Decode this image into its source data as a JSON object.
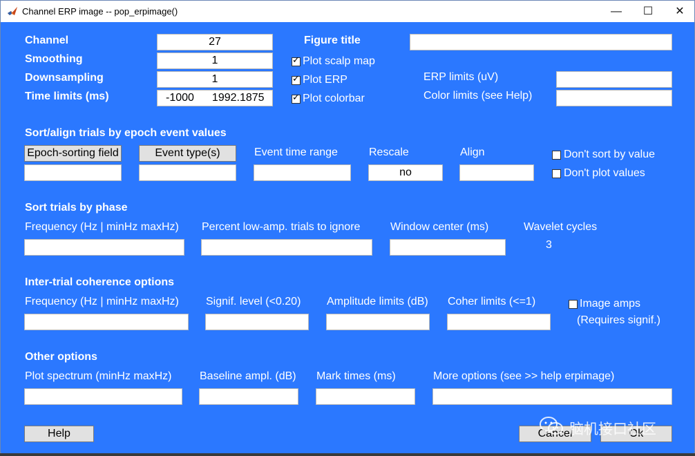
{
  "window": {
    "title": "Channel ERP image -- pop_erpimage()",
    "minimize_glyph": "—",
    "maximize_glyph": "☐",
    "close_glyph": "✕"
  },
  "colors": {
    "panel_bg": "#2b78ff",
    "label_text": "#ffffff",
    "field_bg": "#ffffff",
    "button_bg": "#e1e1e1"
  },
  "top": {
    "channel_label": "Channel",
    "channel_value": "27",
    "smoothing_label": "Smoothing",
    "smoothing_value": "1",
    "downsampling_label": "Downsampling",
    "downsampling_value": "1",
    "time_limits_label": "Time limits (ms)",
    "time_limits_min": "-1000",
    "time_limits_max": "1992.1875",
    "figure_title_label": "Figure title",
    "figure_title_value": "",
    "plot_scalp_map": "Plot scalp map",
    "plot_scalp_map_checked": true,
    "plot_erp": "Plot ERP",
    "plot_erp_checked": true,
    "plot_colorbar": "Plot colorbar",
    "plot_colorbar_checked": true,
    "erp_limits_label": "ERP limits (uV)",
    "erp_limits_value": "",
    "color_limits_label": "Color limits (see Help)",
    "color_limits_value": ""
  },
  "sort": {
    "heading": "Sort/align trials by epoch event values",
    "epoch_sorting_button": "Epoch-sorting field",
    "event_type_button": "Event type(s)",
    "event_time_range_label": "Event time range",
    "rescale_label": "Rescale",
    "rescale_value": "no",
    "align_label": "Align",
    "dont_sort": "Don't sort by value",
    "dont_plot": "Don't plot values"
  },
  "phase": {
    "heading": "Sort trials by phase",
    "frequency_label": "Frequency (Hz | minHz maxHz)",
    "percent_label": "Percent low-amp. trials to ignore",
    "window_center_label": "Window center (ms)",
    "wavelet_cycles_label": "Wavelet cycles",
    "wavelet_cycles_value": "3"
  },
  "itc": {
    "heading": "Inter-trial coherence options",
    "frequency_label": "Frequency (Hz | minHz maxHz)",
    "signif_label": "Signif. level (<0.20)",
    "amplitude_label": "Amplitude limits (dB)",
    "coher_label": "Coher limits (<=1)",
    "image_amps": "Image amps",
    "requires_signif": "(Requires signif.)"
  },
  "other": {
    "heading": "Other options",
    "plot_spectrum_label": "Plot spectrum (minHz maxHz)",
    "baseline_label": "Baseline ampl. (dB)",
    "mark_times_label": "Mark times (ms)",
    "more_options_label": "More options (see >> help erpimage)"
  },
  "footer": {
    "help": "Help",
    "cancel": "Cancel",
    "ok": "Ok"
  },
  "watermark": {
    "text": "脑机接口社区",
    "icon": "wechat-icon"
  }
}
